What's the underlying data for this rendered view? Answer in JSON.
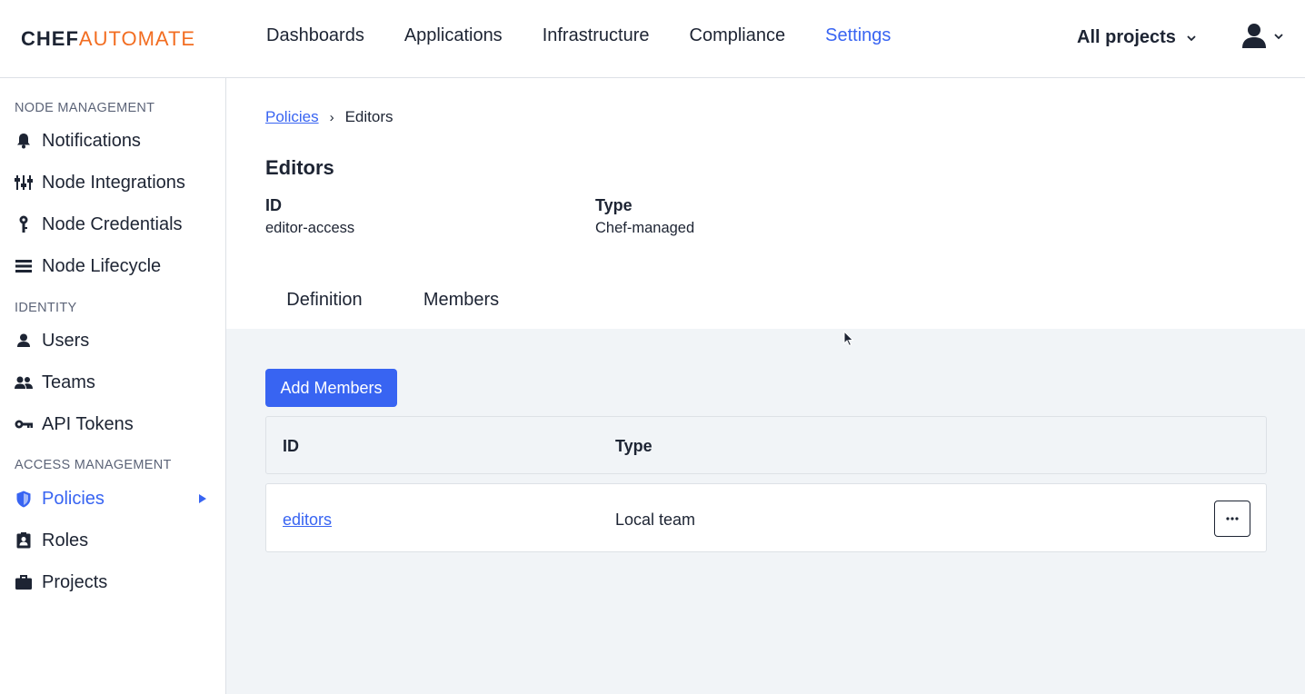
{
  "logo": {
    "part1": "CHEF",
    "part2": "AUTOMATE"
  },
  "nav": {
    "items": [
      {
        "label": "Dashboards"
      },
      {
        "label": "Applications"
      },
      {
        "label": "Infrastructure"
      },
      {
        "label": "Compliance"
      },
      {
        "label": "Settings",
        "active": true
      }
    ],
    "projects_label": "All projects"
  },
  "sidebar": {
    "sections": [
      {
        "title": "NODE MANAGEMENT"
      },
      {
        "title": "IDENTITY"
      },
      {
        "title": "ACCESS MANAGEMENT"
      }
    ],
    "items": [
      {
        "label": "Notifications",
        "icon": "bell-icon"
      },
      {
        "label": "Node Integrations",
        "icon": "sliders-icon"
      },
      {
        "label": "Node Credentials",
        "icon": "key-icon"
      },
      {
        "label": "Node Lifecycle",
        "icon": "list-icon"
      },
      {
        "label": "Users",
        "icon": "person-icon"
      },
      {
        "label": "Teams",
        "icon": "people-icon"
      },
      {
        "label": "API Tokens",
        "icon": "token-key-icon"
      },
      {
        "label": "Policies",
        "icon": "shield-icon",
        "active": true
      },
      {
        "label": "Roles",
        "icon": "badge-icon"
      },
      {
        "label": "Projects",
        "icon": "briefcase-icon"
      }
    ]
  },
  "breadcrumb": {
    "parent": "Policies",
    "current": "Editors"
  },
  "policy": {
    "title": "Editors",
    "id_label": "ID",
    "id_value": "editor-access",
    "type_label": "Type",
    "type_value": "Chef-managed"
  },
  "tabs": [
    {
      "label": "Definition"
    },
    {
      "label": "Members",
      "active": true
    }
  ],
  "members": {
    "add_label": "Add Members",
    "columns": [
      "ID",
      "Type"
    ],
    "rows": [
      {
        "id": "editors",
        "type": "Local team"
      }
    ],
    "more_label": "···"
  },
  "colors": {
    "accent": "#3864f2",
    "brand_orange": "#f26d21",
    "body_bg": "#f1f4f7"
  }
}
